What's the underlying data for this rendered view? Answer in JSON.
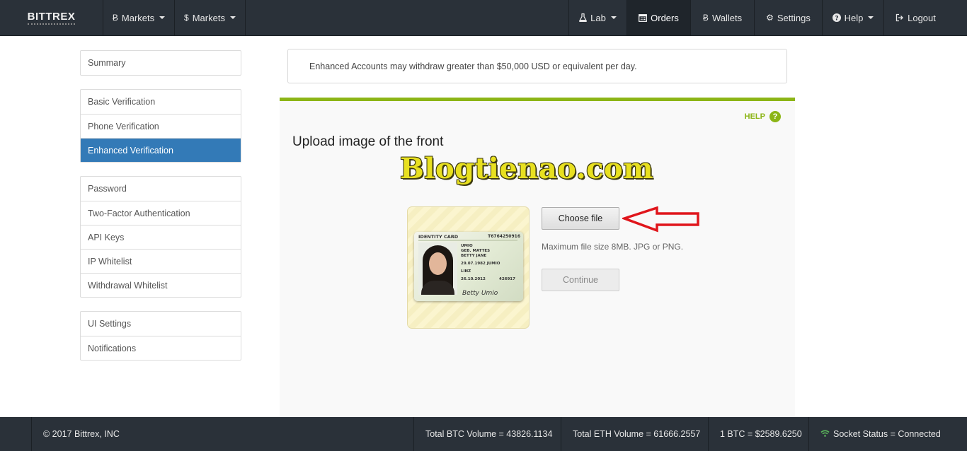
{
  "navbar": {
    "brand": "BITTREX",
    "left_items": [
      {
        "icon": "bitcoin-icon",
        "symbol": "Ƀ",
        "label": "Markets"
      },
      {
        "icon": "dollar-icon",
        "symbol": "$",
        "label": "Markets"
      }
    ],
    "right_items": [
      {
        "icon": "flask-icon",
        "label": "Lab"
      },
      {
        "icon": "calendar-icon",
        "label": "Orders"
      },
      {
        "icon": "bitcoin-icon",
        "label": "Wallets"
      },
      {
        "icon": "gear-icon",
        "label": "Settings"
      },
      {
        "icon": "question-icon",
        "label": "Help"
      },
      {
        "icon": "logout-icon",
        "label": "Logout"
      }
    ],
    "active_item": "Orders"
  },
  "sidebar": {
    "group1": [
      {
        "label": "Summary"
      }
    ],
    "group2": [
      {
        "label": "Basic Verification"
      },
      {
        "label": "Phone Verification"
      },
      {
        "label": "Enhanced Verification"
      }
    ],
    "group3": [
      {
        "label": "Password"
      },
      {
        "label": "Two-Factor Authentication"
      },
      {
        "label": "API Keys"
      },
      {
        "label": "IP Whitelist"
      },
      {
        "label": "Withdrawal Whitelist"
      }
    ],
    "group4": [
      {
        "label": "UI Settings"
      },
      {
        "label": "Notifications"
      }
    ],
    "active_item": "Enhanced Verification"
  },
  "info": {
    "text": "Enhanced Accounts may withdraw greater than $50,000 USD or equivalent per day."
  },
  "upload": {
    "help_label": "HELP",
    "help_icon": "?",
    "title": "Upload image of the front",
    "watermark": "Blogtienao.com",
    "choose_label": "Choose file",
    "max_size": "Maximum file size 8MB. JPG or PNG.",
    "continue_label": "Continue",
    "id_card": {
      "header": "IDENTITY CARD",
      "number": "T6764250916",
      "surname": "UMIO",
      "born_name": "GEB. MATTES",
      "given_name": "BETTY JANE",
      "birth_date": "29.07.1982 JUMIO",
      "place": "LINZ",
      "expiry": "26.10.2012",
      "code": "426917",
      "signature": "Betty Umio"
    }
  },
  "footer": {
    "copyright": "© 2017 Bittrex, INC",
    "btc_volume": "Total BTC Volume = 43826.1134",
    "eth_volume": "Total ETH Volume = 61666.2557",
    "btc_price": "1 BTC = $2589.6250",
    "socket_status": "Socket Status = Connected"
  },
  "colors": {
    "navbar": "#2a3139",
    "active_blue": "#337ab7",
    "accent_green": "#8cb516",
    "arrow_red": "#e0161c",
    "watermark_yellow": "#e8e020"
  }
}
